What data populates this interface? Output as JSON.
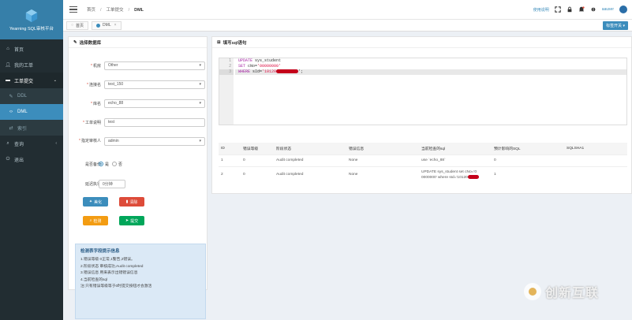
{
  "app": {
    "title": "Yearning SQL审核平台"
  },
  "colors": {
    "sidebar_bg": "#222d32",
    "accent": "#3c8dbc",
    "logo_bg": "#367fa9"
  },
  "sidebar": {
    "items": [
      {
        "label": "首页",
        "icon": "home-icon"
      },
      {
        "label": "我的工单",
        "icon": "user-icon"
      },
      {
        "label": "工单提交",
        "icon": "folder-icon"
      }
    ],
    "sub_items": [
      {
        "label": "DDL",
        "icon": "edit-icon"
      },
      {
        "label": "DML",
        "icon": "code-icon"
      },
      {
        "label": "索引",
        "icon": "index-icon"
      }
    ],
    "bottom_items": [
      {
        "label": "查询",
        "icon": "search-icon"
      },
      {
        "label": "退出",
        "icon": "logout-icon"
      }
    ]
  },
  "header": {
    "breadcrumb": [
      "首页",
      "工单提交",
      "DML"
    ],
    "link": "使用说明",
    "username": "aauser"
  },
  "tabs": {
    "home": "首页",
    "active": "DML",
    "right_button": "标签开关"
  },
  "left_panel": {
    "title": "选择数据库",
    "fields": [
      {
        "label": "机房",
        "value": "Other"
      },
      {
        "label": "连接名",
        "value": "test_150"
      },
      {
        "label": "库名",
        "value": "echo_88"
      },
      {
        "label": "工单说明",
        "value": "test"
      },
      {
        "label": "指定审核人",
        "value": "admin"
      }
    ],
    "backup": {
      "label": "是否备份",
      "yes": "是",
      "no": "否"
    },
    "delay": {
      "label": "延迟执行",
      "value": "0分钟"
    },
    "buttons": {
      "format": "美化",
      "clear": "清除",
      "check": "检测",
      "submit": "提交"
    },
    "info": {
      "title": "检测表字段提示信息",
      "lines": [
        "1.错误等级 0正常,1警告,2错误。",
        "2.阶段状态 审核成功,Audit completed",
        "3.错误信息 用来表示出错错误信息",
        "4.当前检查的sql",
        "注:只有错误等级等于0时提交按钮才会激活"
      ]
    }
  },
  "right_panel": {
    "title": "填写sql语句",
    "code": {
      "lines": [
        {
          "kw": "UPDATE",
          "rest": " sys_student"
        },
        {
          "kw": "SET",
          "rest": " cNo=",
          "str": "'00000000'"
        },
        {
          "kw": "WHERE",
          "rest": " sId=",
          "str": "'10120",
          "tail": "';"
        }
      ],
      "line_numbers": [
        "1",
        "2",
        "3"
      ]
    },
    "table": {
      "headers": [
        "ID",
        "错误等级",
        "阶段状态",
        "错误信息",
        "当前检查的sql",
        "预计影响的SQL",
        "SQLSHA1"
      ],
      "rows": [
        {
          "id": "1",
          "level": "0",
          "stage": "Audit completed",
          "error": "None",
          "sql": "use `echo_88`",
          "affected": "0",
          "sha": ""
        },
        {
          "id": "2",
          "level": "0",
          "stage": "Audit completed",
          "error": "None",
          "sql": "UPDATE sys_student set cNo='0\n0000000' where sId='10120",
          "affected": "1",
          "sha": ""
        }
      ]
    }
  },
  "watermark": {
    "text": "创新互联"
  }
}
